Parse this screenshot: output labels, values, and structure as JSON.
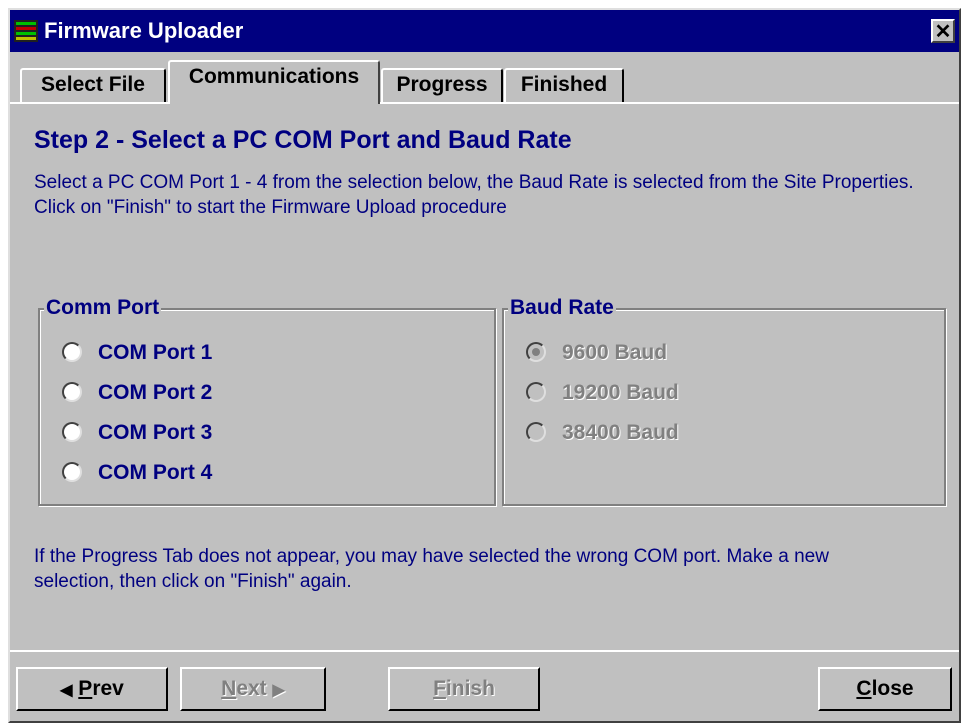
{
  "window": {
    "title": "Firmware Uploader",
    "close_glyph": "✕",
    "app_icon": "app-icon"
  },
  "tabs": [
    {
      "label": "Select File",
      "active": false
    },
    {
      "label": "Communications",
      "active": true
    },
    {
      "label": "Progress",
      "active": false
    },
    {
      "label": "Finished",
      "active": false
    }
  ],
  "panel": {
    "step_title": "Step 2 - Select a PC COM Port and Baud Rate",
    "description": "Select a PC COM Port 1 - 4 from the selection below, the Baud Rate is selected from the Site Properties.  Click on \"Finish\" to start the Firmware Upload procedure",
    "comm_port": {
      "label": "Comm Port",
      "options": [
        {
          "label": "COM Port 1",
          "selected": false
        },
        {
          "label": "COM Port 2",
          "selected": false
        },
        {
          "label": "COM Port 3",
          "selected": false
        },
        {
          "label": "COM Port 4",
          "selected": false
        }
      ]
    },
    "baud_rate": {
      "label": "Baud Rate",
      "disabled": true,
      "options": [
        {
          "label": "9600 Baud",
          "selected": true
        },
        {
          "label": "19200 Baud",
          "selected": false
        },
        {
          "label": "38400 Baud",
          "selected": false
        }
      ]
    },
    "note": "If the Progress Tab does not appear, you may have selected the wrong COM port. Make a new selection, then click on \"Finish\" again."
  },
  "buttons": {
    "prev": {
      "arrow": "◀",
      "mnemonic": "P",
      "rest": "rev",
      "enabled": true
    },
    "next": {
      "mnemonic": "N",
      "rest": "ext",
      "arrow": "▶",
      "enabled": false
    },
    "finish": {
      "mnemonic": "F",
      "rest": "inish",
      "enabled": false
    },
    "close": {
      "mnemonic": "C",
      "rest": "lose",
      "enabled": true
    }
  },
  "colors": {
    "titlebar": "#000080",
    "face": "#c0c0c0",
    "label_text": "#000080",
    "disabled_text": "#808080"
  }
}
